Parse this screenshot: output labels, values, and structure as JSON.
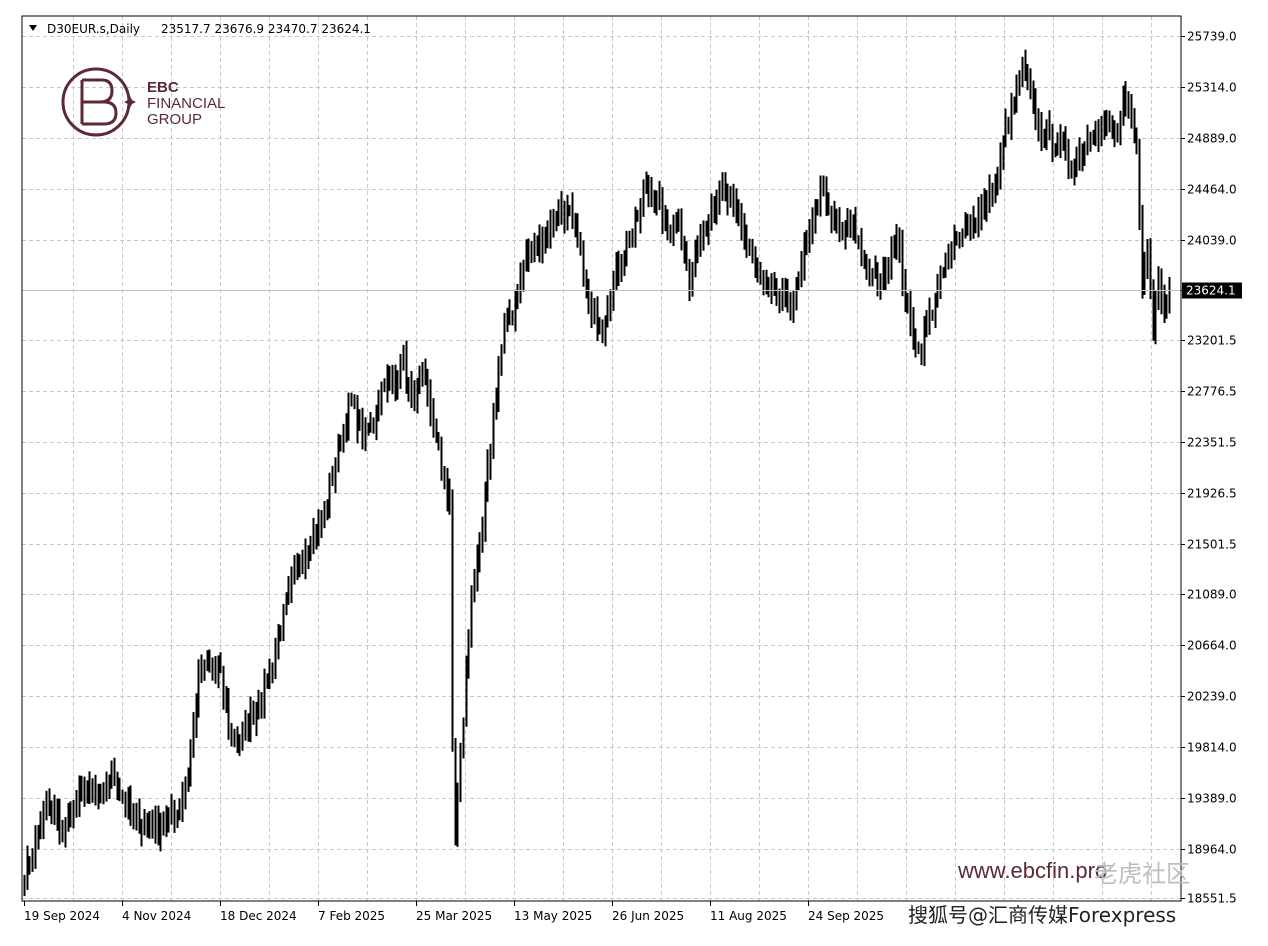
{
  "header": {
    "symbol": "D30EUR.s,Daily",
    "ohlc": "23517.7 23676.9 23470.7 23624.1"
  },
  "logo": {
    "brand": "EBC",
    "line1": "FINANCIAL",
    "line2": "GROUP"
  },
  "watermarks": {
    "url": "www.ebcfin.pro",
    "community": "老虎社区",
    "source": "搜狐号@汇商传媒Forexpress"
  },
  "colors": {
    "bars": "#000000",
    "grid": "#c8c8c8",
    "frame": "#000000",
    "price_line": "#c0c0c0",
    "price_label_bg": "#000000",
    "price_label_text": "#ffffff",
    "logo": "#5b2a33"
  },
  "chart_data": {
    "type": "ohlc",
    "ylim": [
      18551.5,
      25739.0
    ],
    "y_ticks": [
      "25739.0",
      "25314.0",
      "24889.0",
      "24464.0",
      "24039.0",
      "23624.1",
      "23201.5",
      "22776.5",
      "22351.5",
      "21926.5",
      "21501.5",
      "21089.0",
      "20664.0",
      "20239.0",
      "19814.0",
      "19389.0",
      "18964.0",
      "18551.5"
    ],
    "x_ticks": [
      "19 Sep 2024",
      "4 Nov 2024",
      "18 Dec 2024",
      "7 Feb 2025",
      "25 Mar 2025",
      "13 May 2025",
      "26 Jun 2025",
      "11 Aug 2025",
      "24 Sep 2025"
    ],
    "current_price": 23624.1,
    "close_path": [
      [
        0,
        18750
      ],
      [
        8,
        19350
      ],
      [
        14,
        19100
      ],
      [
        22,
        19480
      ],
      [
        28,
        19350
      ],
      [
        32,
        19600
      ],
      [
        40,
        19200
      ],
      [
        48,
        19150
      ],
      [
        56,
        19250
      ],
      [
        60,
        19600
      ],
      [
        64,
        20400
      ],
      [
        68,
        20500
      ],
      [
        72,
        20400
      ],
      [
        76,
        19900
      ],
      [
        80,
        19880
      ],
      [
        84,
        20100
      ],
      [
        88,
        20300
      ],
      [
        92,
        20600
      ],
      [
        96,
        21000
      ],
      [
        100,
        21300
      ],
      [
        104,
        21500
      ],
      [
        108,
        21650
      ],
      [
        112,
        21950
      ],
      [
        116,
        22400
      ],
      [
        120,
        22700
      ],
      [
        124,
        22400
      ],
      [
        128,
        22500
      ],
      [
        132,
        22900
      ],
      [
        136,
        22800
      ],
      [
        138,
        23100
      ],
      [
        142,
        22700
      ],
      [
        146,
        22900
      ],
      [
        150,
        22500
      ],
      [
        156,
        21800
      ],
      [
        157,
        19800
      ],
      [
        158,
        19100
      ],
      [
        160,
        19700
      ],
      [
        162,
        20400
      ],
      [
        164,
        21100
      ],
      [
        166,
        21300
      ],
      [
        168,
        21650
      ],
      [
        170,
        22100
      ],
      [
        172,
        22600
      ],
      [
        176,
        23300
      ],
      [
        180,
        23500
      ],
      [
        184,
        23900
      ],
      [
        188,
        24000
      ],
      [
        192,
        24100
      ],
      [
        196,
        24300
      ],
      [
        200,
        24250
      ],
      [
        204,
        23900
      ],
      [
        208,
        23400
      ],
      [
        212,
        23350
      ],
      [
        216,
        23700
      ],
      [
        220,
        23950
      ],
      [
        224,
        24150
      ],
      [
        228,
        24500
      ],
      [
        232,
        24350
      ],
      [
        236,
        24100
      ],
      [
        240,
        24250
      ],
      [
        244,
        23650
      ],
      [
        248,
        24100
      ],
      [
        252,
        24300
      ],
      [
        256,
        24450
      ],
      [
        260,
        24300
      ],
      [
        264,
        24100
      ],
      [
        268,
        23800
      ],
      [
        272,
        23600
      ],
      [
        276,
        23550
      ],
      [
        280,
        23500
      ],
      [
        284,
        23650
      ],
      [
        288,
        24150
      ],
      [
        292,
        24450
      ],
      [
        296,
        24200
      ],
      [
        300,
        24100
      ],
      [
        304,
        24200
      ],
      [
        308,
        23800
      ],
      [
        312,
        23700
      ],
      [
        316,
        23800
      ],
      [
        320,
        24100
      ],
      [
        324,
        23400
      ],
      [
        328,
        23100
      ],
      [
        332,
        23400
      ],
      [
        336,
        23700
      ],
      [
        340,
        23950
      ],
      [
        344,
        24150
      ],
      [
        348,
        24200
      ],
      [
        352,
        24300
      ],
      [
        356,
        24500
      ],
      [
        360,
        24950
      ],
      [
        364,
        25250
      ],
      [
        366,
        25450
      ],
      [
        368,
        25300
      ],
      [
        372,
        24950
      ],
      [
        376,
        24900
      ],
      [
        380,
        24850
      ],
      [
        384,
        24650
      ],
      [
        388,
        24800
      ],
      [
        392,
        24950
      ],
      [
        396,
        25000
      ],
      [
        400,
        24900
      ],
      [
        404,
        25200
      ],
      [
        408,
        24800
      ],
      [
        410,
        23700
      ],
      [
        412,
        23900
      ],
      [
        414,
        23300
      ],
      [
        416,
        23700
      ],
      [
        418,
        23500
      ],
      [
        420,
        23624
      ]
    ]
  }
}
